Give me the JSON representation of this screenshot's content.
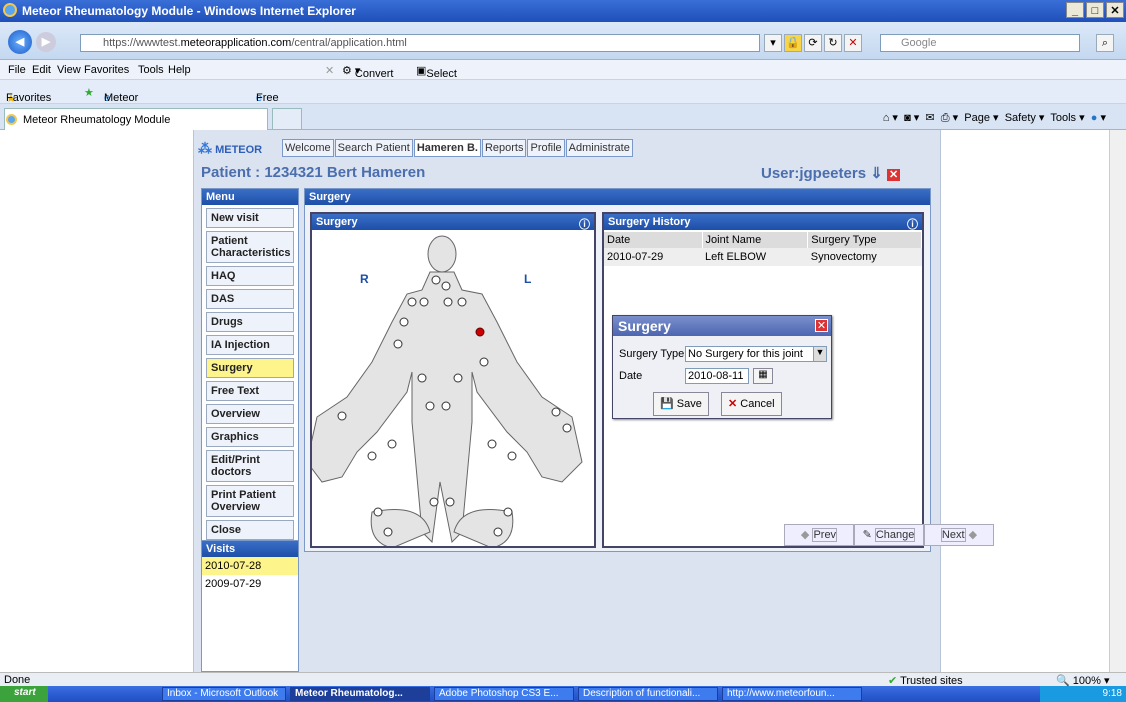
{
  "browser": {
    "title": "Meteor Rheumatology Module - Windows Internet Explorer",
    "url_prefix": "https://wwwtest.",
    "url_domain": "meteorapplication.com",
    "url_path": "/central/application.html",
    "search_placeholder": "Google",
    "menu": [
      "File",
      "Edit",
      "View",
      "Favorites",
      "Tools",
      "Help"
    ],
    "convert_label": "Convert",
    "select_label": "Select",
    "favorites_label": "Favorites",
    "fav_links": [
      "Meteor Rheumatology Module",
      "Free Hotmail"
    ],
    "tab_label": "Meteor Rheumatology Module",
    "cmd": [
      "Page",
      "Safety",
      "Tools"
    ]
  },
  "app": {
    "logo": "METEOR",
    "nav_tabs": [
      "Welcome",
      "Search Patient",
      "Hameren B.",
      "Reports",
      "Profile",
      "Administrate"
    ],
    "patient_title": "Patient : 1234321 Bert Hameren",
    "user_label": "User:jgpeeters",
    "menu_header": "Menu",
    "menu_items": [
      "New visit",
      "Patient Characteristics",
      "HAQ",
      "DAS",
      "Drugs",
      "IA Injection",
      "Surgery",
      "Free Text",
      "Overview",
      "Graphics",
      "Edit/Print doctors",
      "Print Patient Overview",
      "Close"
    ],
    "visits_header": "Visits",
    "visits": [
      "2010-07-28",
      "2009-07-29"
    ],
    "main_header": "Surgery",
    "body_panel_title": "Surgery",
    "side_right": "R",
    "side_left": "L",
    "history_title": "Surgery History",
    "history_columns": [
      "Date",
      "Joint Name",
      "Surgery Type"
    ],
    "history_rows": [
      [
        "2010-07-29",
        "Left ELBOW",
        "Synovectomy"
      ]
    ],
    "pager": {
      "prev": "Prev",
      "change": "Change",
      "next": "Next"
    },
    "dialog": {
      "title": "Surgery",
      "type_label": "Surgery Type",
      "type_value": "No Surgery for this joint",
      "date_label": "Date",
      "date_value": "2010-08-11",
      "save": "Save",
      "cancel": "Cancel"
    }
  },
  "status": {
    "left": "Done",
    "zone": "Trusted sites",
    "zoom": "100%"
  },
  "taskbar": {
    "start": "start",
    "items": [
      "Inbox - Microsoft Outlook",
      "Meteor Rheumatolog...",
      "Adobe Photoshop CS3 E...",
      "Description of functionali...",
      "http://www.meteorfoun..."
    ],
    "clock": "9:18"
  },
  "colors": {
    "accent": "#1d4ea8",
    "selected": "#fdf48c",
    "joint_marked": "#cc0000"
  }
}
